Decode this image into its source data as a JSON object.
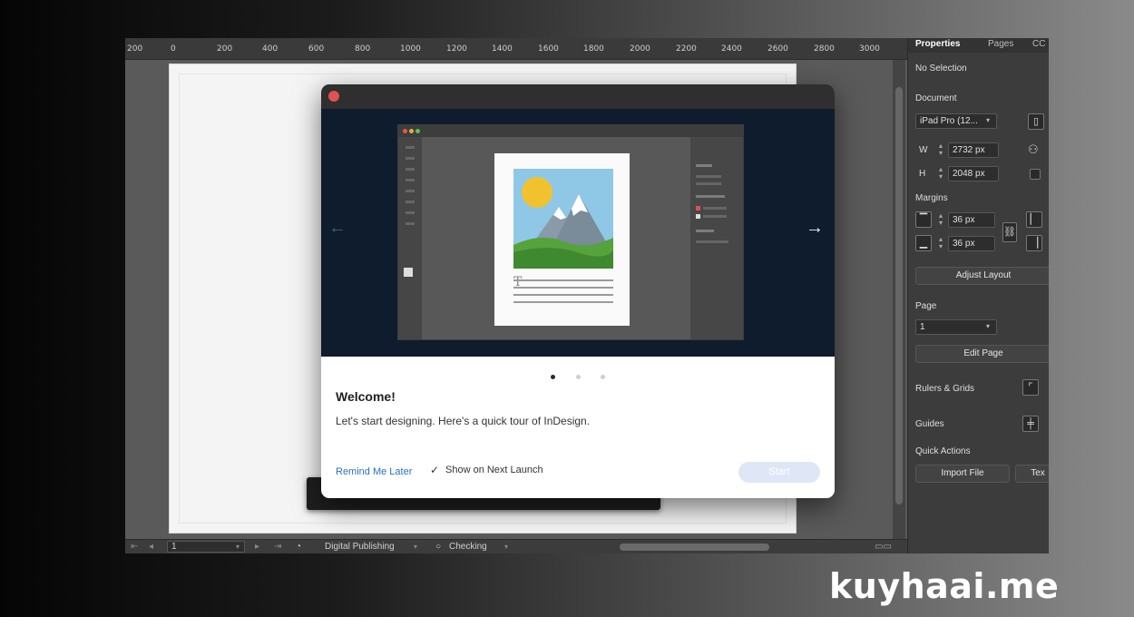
{
  "ruler": {
    "ticks": [
      "200",
      "0",
      "200",
      "400",
      "600",
      "800",
      "1000",
      "1200",
      "1400",
      "1600",
      "1800",
      "2000",
      "2200",
      "2400",
      "2600",
      "2800",
      "3000"
    ]
  },
  "statusbar": {
    "page_value": "1",
    "preset": "Digital Publishing",
    "preflight": "Checking"
  },
  "panel": {
    "tabs": {
      "properties": "Properties",
      "pages": "Pages",
      "cc": "CC"
    },
    "no_selection": "No Selection",
    "document": {
      "heading": "Document",
      "preset_value": "iPad Pro (12...",
      "width_label": "W",
      "width_value": "2732 px",
      "height_label": "H",
      "height_value": "2048 px"
    },
    "margins": {
      "heading": "Margins",
      "top_value": "36 px",
      "bottom_value": "36 px"
    },
    "adjust_layout": "Adjust Layout",
    "page": {
      "heading": "Page",
      "value": "1",
      "edit_page": "Edit Page"
    },
    "rulers_grids": "Rulers & Grids",
    "guides": "Guides",
    "quick_actions": "Quick Actions",
    "import_file": "Import File",
    "text_button": "Tex"
  },
  "dialog": {
    "heading": "Welcome!",
    "subtitle": "Let's start designing. Here's a quick tour of InDesign.",
    "remind_later": "Remind Me Later",
    "show_next_launch": "Show on Next Launch",
    "show_next_launch_checked": true,
    "start_button": "Start",
    "carousel_active_index": 0,
    "carousel_count": 3,
    "arrow_next": "→",
    "arrow_prev": "←"
  },
  "watermark": "kuyhaai.me",
  "colors": {
    "link": "#2b6fc2",
    "carousel_bg": "#0e1c2d",
    "close_button": "#e05252",
    "panel_bg": "#3c3c3c"
  }
}
